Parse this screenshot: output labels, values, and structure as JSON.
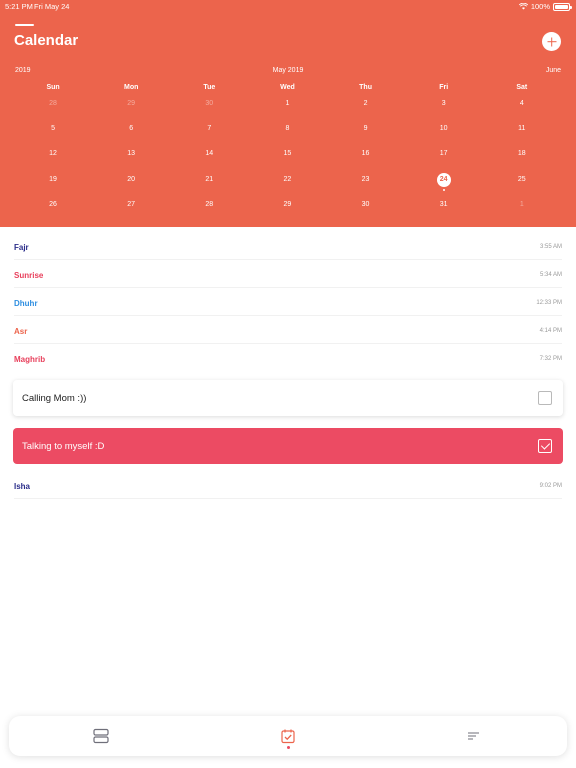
{
  "status_bar": {
    "time": "5:21 PM",
    "date": "Fri May 24",
    "battery": "100%"
  },
  "header": {
    "title": "Calendar",
    "prev_label": "2019",
    "current_label": "May 2019",
    "next_label": "June"
  },
  "calendar": {
    "weekdays": [
      "Sun",
      "Mon",
      "Tue",
      "Wed",
      "Thu",
      "Fri",
      "Sat"
    ],
    "weeks": [
      [
        "28",
        "29",
        "30",
        "1",
        "2",
        "3",
        "4"
      ],
      [
        "5",
        "6",
        "7",
        "8",
        "9",
        "10",
        "11"
      ],
      [
        "12",
        "13",
        "14",
        "15",
        "16",
        "17",
        "18"
      ],
      [
        "19",
        "20",
        "21",
        "22",
        "23",
        "24",
        "25"
      ],
      [
        "26",
        "27",
        "28",
        "29",
        "30",
        "31",
        "1"
      ]
    ],
    "today": "24"
  },
  "prayers": [
    {
      "name": "Fajr",
      "time": "3:55 AM",
      "color": "#2b2d8a"
    },
    {
      "name": "Sunrise",
      "time": "5:34 AM",
      "color": "#e83f5b"
    },
    {
      "name": "Dhuhr",
      "time": "12:33 PM",
      "color": "#2e8ee0"
    },
    {
      "name": "Asr",
      "time": "4:14 PM",
      "color": "#ec644c"
    },
    {
      "name": "Maghrib",
      "time": "7:32 PM",
      "color": "#e83f5b"
    },
    {
      "name": "Isha",
      "time": "9:02 PM",
      "color": "#2b2d8a"
    }
  ],
  "tasks": [
    {
      "label": "Calling Mom :))",
      "checked": false
    },
    {
      "label": "Talking to myself :D",
      "checked": true
    }
  ],
  "tabs": [
    {
      "icon": "stack-icon",
      "active": false
    },
    {
      "icon": "calendar-check-icon",
      "active": true
    },
    {
      "icon": "menu-lines-icon",
      "active": false
    }
  ],
  "colors": {
    "accent": "#ec644c",
    "task_highlight": "#ec4b63"
  }
}
